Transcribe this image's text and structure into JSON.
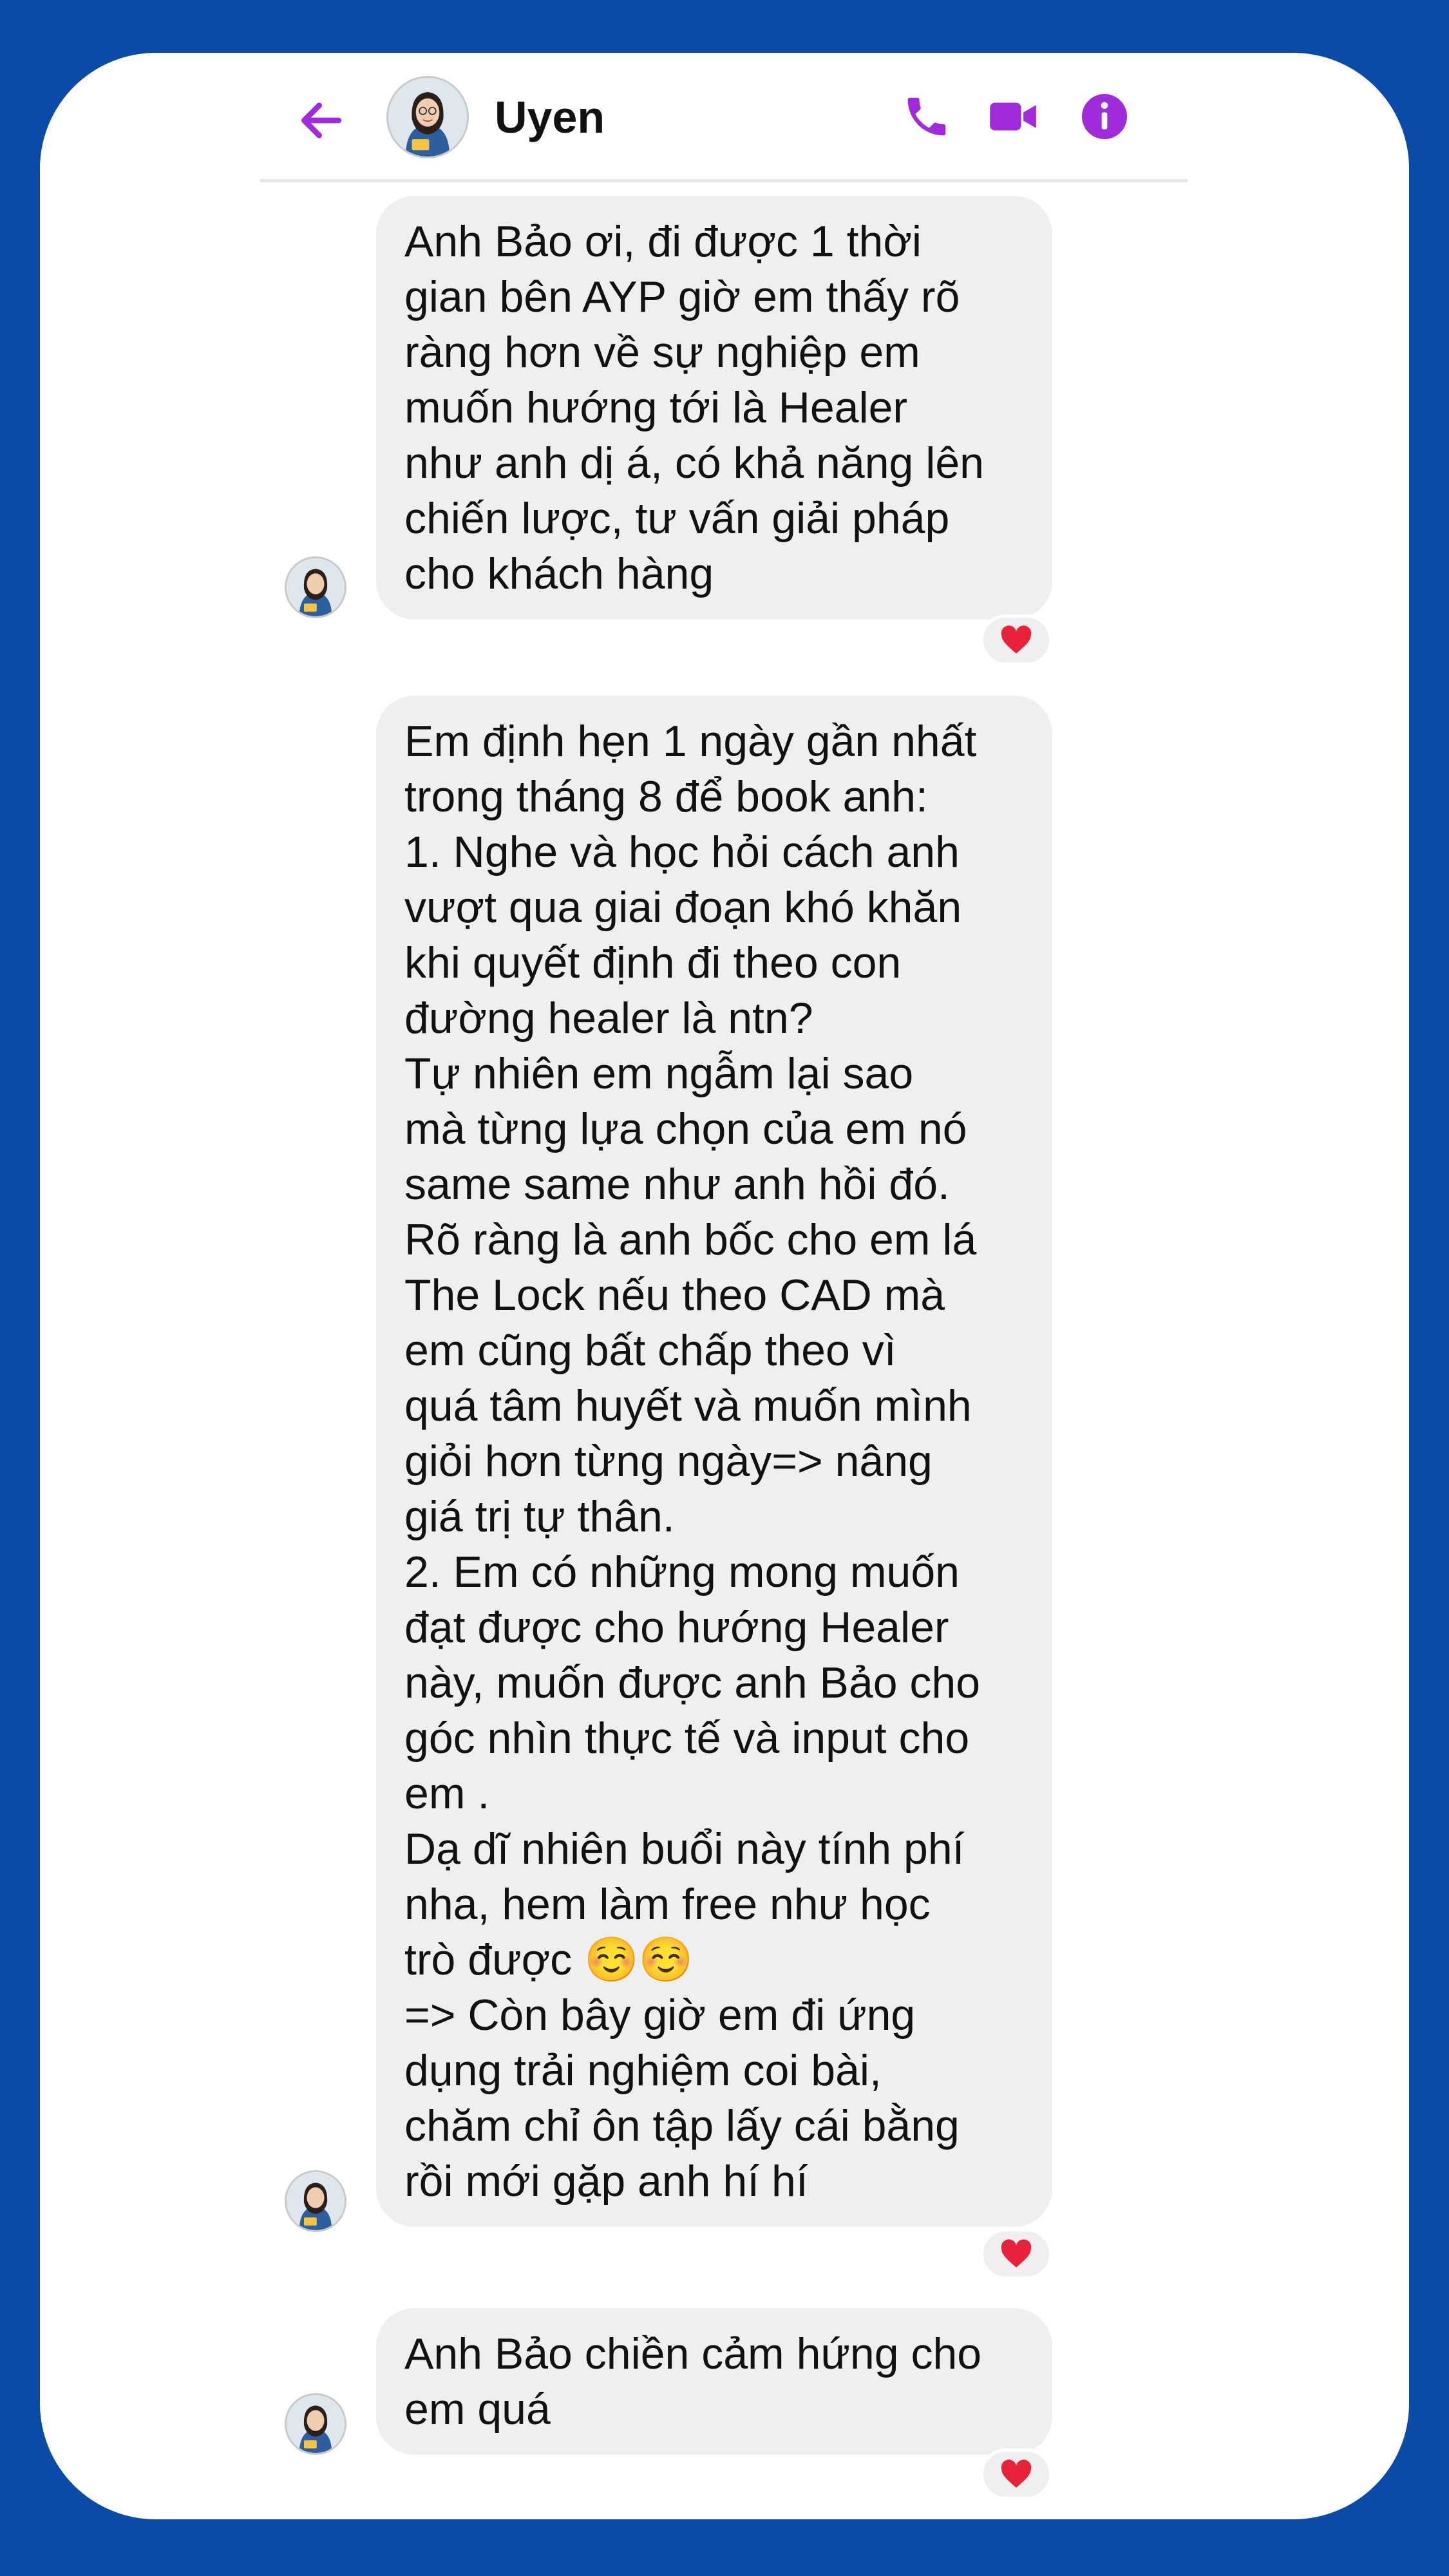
{
  "header": {
    "contact_name": "Uyen",
    "back_icon": "arrow-left-icon",
    "call_icon": "phone-icon",
    "video_icon": "video-camera-icon",
    "info_icon": "info-icon"
  },
  "colors": {
    "background": "#0a4aa8",
    "accent": "#a02bdb",
    "bubble": "#efefef",
    "heart": "#e8223b"
  },
  "messages": [
    {
      "text": "Anh Bảo ơi, đi được 1 thời\ngian bên AYP giờ em thấy rõ\nràng hơn về sự nghiệp em\nmuốn hướng tới là Healer\nnhư anh dị á, có khả năng lên\nchiến lược, tư vấn giải pháp\ncho khách hàng",
      "reaction": "heart"
    },
    {
      "text": "Em định hẹn 1 ngày gần nhất\ntrong tháng 8 để book anh:\n1. Nghe và học hỏi cách anh\nvượt qua giai đoạn khó khăn\nkhi quyết định đi theo con\nđường healer là ntn?\nTự nhiên em ngẫm lại sao\nmà từng lựa chọn của em nó\nsame same như anh hồi đó.\nRõ ràng là anh bốc cho em lá\nThe Lock nếu theo CAD mà\nem cũng bất chấp theo vì\nquá tâm huyết và muốn mình\ngiỏi hơn từng ngày=> nâng\ngiá trị tự thân.\n2. Em có những mong muốn\nđạt được cho hướng Healer\nnày, muốn được anh Bảo cho\ngóc nhìn thực tế và input cho\nem .\nDạ dĩ nhiên buổi này tính phí\nnha, hem làm free như học\ntrò được ☺️☺️\n=> Còn bây giờ em đi ứng\ndụng trải nghiệm coi bài,\nchăm chỉ ôn tập lấy cái bằng\nrồi mới gặp anh hí hí",
      "reaction": "heart"
    },
    {
      "text": "Anh Bảo chiền cảm hứng cho\nem quá",
      "reaction": "heart"
    }
  ]
}
